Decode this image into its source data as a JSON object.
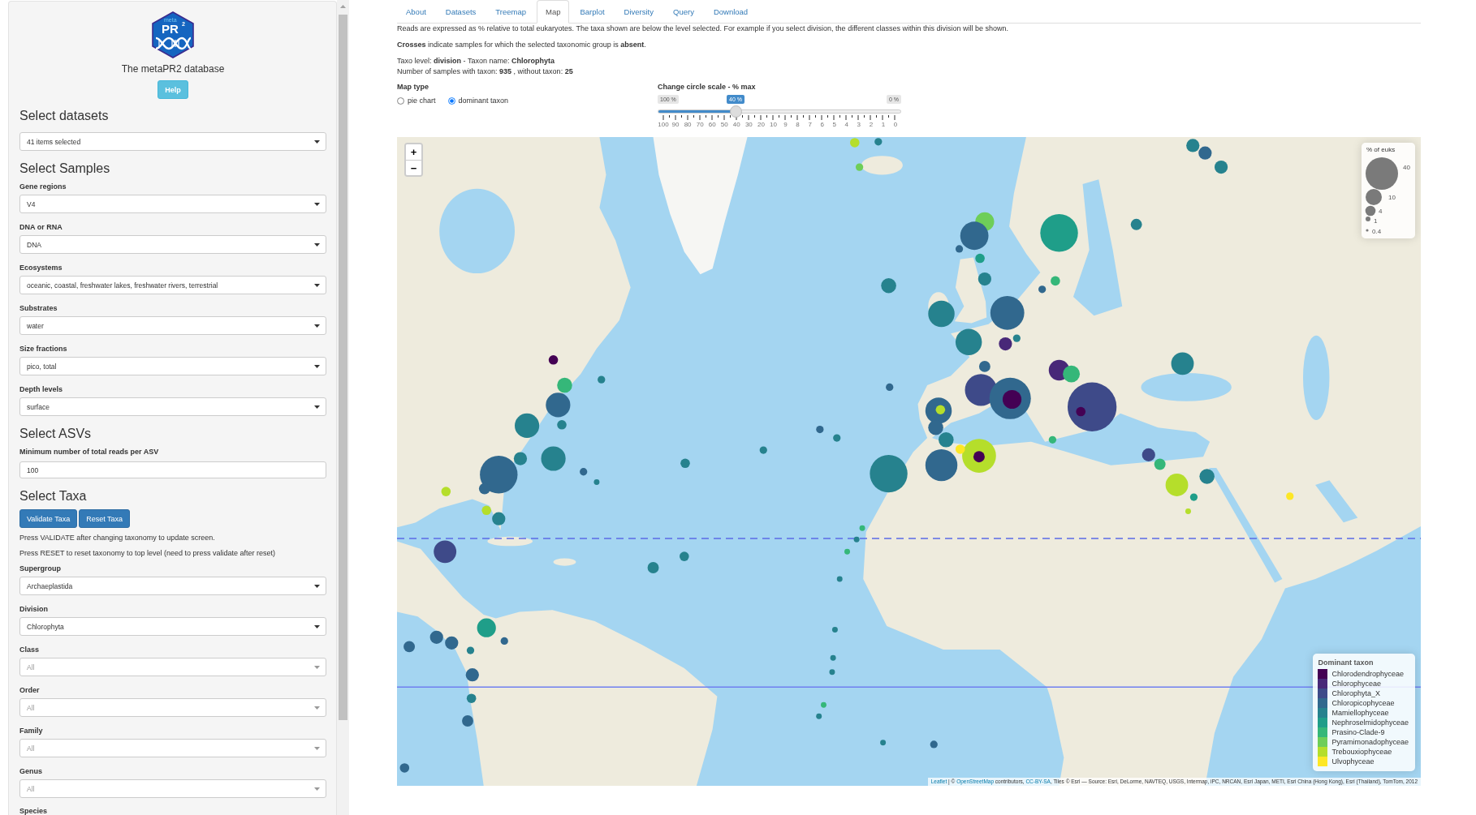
{
  "sidebar": {
    "logo": {
      "small": "meta",
      "main": "PR",
      "sup": "2"
    },
    "title": "The metaPR2 database",
    "help_button": "Help",
    "sections": [
      {
        "heading": "Select datasets",
        "items": [
          {
            "kind": "select",
            "value": "41 items selected"
          }
        ]
      },
      {
        "heading": "Select Samples",
        "items": [
          {
            "kind": "select",
            "label": "Gene regions",
            "value": "V4"
          },
          {
            "kind": "select",
            "label": "DNA or RNA",
            "value": "DNA"
          },
          {
            "kind": "select",
            "label": "Ecosystems",
            "value": "oceanic, coastal, freshwater lakes, freshwater rivers, terrestrial"
          },
          {
            "kind": "select",
            "label": "Substrates",
            "value": "water"
          },
          {
            "kind": "select",
            "label": "Size fractions",
            "value": "pico, total"
          },
          {
            "kind": "select",
            "label": "Depth levels",
            "value": "surface"
          }
        ]
      },
      {
        "heading": "Select ASVs",
        "items": [
          {
            "kind": "input",
            "label": "Minimum number of total reads per ASV",
            "value": "100"
          }
        ]
      },
      {
        "heading": "Select Taxa",
        "items": [
          {
            "kind": "buttons",
            "buttons": [
              "Validate Taxa",
              "Reset Taxa"
            ]
          },
          {
            "kind": "note",
            "text": "Press VALIDATE after changing taxonomy to update screen."
          },
          {
            "kind": "note",
            "text": "Press RESET to reset taxonomy to top level (need to press validate after reset)"
          },
          {
            "kind": "select",
            "label": "Supergroup",
            "value": "Archaeplastida"
          },
          {
            "kind": "select",
            "label": "Division",
            "value": "Chlorophyta"
          },
          {
            "kind": "select",
            "label": "Class",
            "placeholder": "All"
          },
          {
            "kind": "select",
            "label": "Order",
            "placeholder": "All"
          },
          {
            "kind": "select",
            "label": "Family",
            "placeholder": "All"
          },
          {
            "kind": "select",
            "label": "Genus",
            "placeholder": "All"
          },
          {
            "kind": "label",
            "label": "Species"
          }
        ]
      }
    ]
  },
  "tabs": [
    {
      "label": "About",
      "selected": false
    },
    {
      "label": "Datasets",
      "selected": false
    },
    {
      "label": "Treemap",
      "selected": false
    },
    {
      "label": "Map",
      "selected": true
    },
    {
      "label": "Barplot",
      "selected": false
    },
    {
      "label": "Diversity",
      "selected": false
    },
    {
      "label": "Query",
      "selected": false
    },
    {
      "label": "Download",
      "selected": false
    }
  ],
  "info": [
    [
      "Reads are expressed as % relative to total eukaryotes. The taxa shown are below the level selected. For example if you select division, the different classes within this division will be shown."
    ],
    [
      "**Crosses** indicate samples for which the selected taxonomic group is **absent**."
    ],
    [
      "Taxo level: **division** - Taxon name: **Chlorophyta**",
      "Number of samples with taxon: **935** , without taxon: **25**"
    ]
  ],
  "map_type": {
    "label": "Map type",
    "options": [
      {
        "label": "pie chart",
        "selected": false
      },
      {
        "label": "dominant taxon",
        "selected": true
      }
    ]
  },
  "scale_slider": {
    "label": "Change circle scale - % max",
    "min_label": "100 %",
    "max_label": "0 %",
    "value_label": "40 %",
    "level": 0.32,
    "ticks": [
      "100",
      "90",
      "80",
      "70",
      "60",
      "50",
      "40",
      "30",
      "20",
      "10",
      "9",
      "8",
      "7",
      "6",
      "5",
      "4",
      "3",
      "2",
      "1",
      "0"
    ]
  },
  "map": {
    "zoom_controls": [
      "+",
      "−"
    ],
    "size_legend": {
      "title": "% of euks",
      "entries": [
        "40",
        "10",
        "4",
        "1",
        "0.4"
      ]
    },
    "taxon_legend": {
      "title": "Dominant taxon",
      "items": [
        {
          "name": "Chlorodendrophyceae",
          "color": "#440154"
        },
        {
          "name": "Chlorophyceae",
          "color": "#482878"
        },
        {
          "name": "Chlorophyta_X",
          "color": "#3e4a89"
        },
        {
          "name": "Chloropicophyceae",
          "color": "#31688e"
        },
        {
          "name": "Mamiellophyceae",
          "color": "#26828e"
        },
        {
          "name": "Nephroselmidophyceae",
          "color": "#1f9e89"
        },
        {
          "name": "Prasino-Clade-9",
          "color": "#35b779"
        },
        {
          "name": "Pyramimonadophyceae",
          "color": "#6ece58"
        },
        {
          "name": "Trebouxiophyceae",
          "color": "#b5de2b"
        },
        {
          "name": "Ulvophyceae",
          "color": "#fde725"
        }
      ]
    },
    "attribution": [
      {
        "kind": "link",
        "text": "Leaflet"
      },
      {
        "kind": "text",
        "text": " | © "
      },
      {
        "kind": "link",
        "text": "OpenStreetMap"
      },
      {
        "kind": "text",
        "text": " contributors, "
      },
      {
        "kind": "link",
        "text": "CC-BY-SA"
      },
      {
        "kind": "text",
        "text": ", Tiles © Esri — Source: Esri, DeLorme, NAVTEQ, USGS, Intermap, iPC, NRCAN, Esri Japan, METI, Esri China (Hong Kong), Esri (Thailand), TomTom, 2012"
      }
    ],
    "markers": [
      {
        "color": "#b5de2b"
      },
      {
        "color": "#26828e"
      },
      {
        "color": "#6ece58"
      },
      {
        "color": "#26828e"
      },
      {
        "color": "#31688e"
      },
      {
        "color": "#26828e"
      },
      {
        "color": "#6ece58"
      },
      {
        "color": "#31688e"
      },
      {
        "color": "#1f9e89"
      },
      {
        "color": "#1f9e89"
      },
      {
        "color": "#31688e"
      },
      {
        "color": "#26828e"
      },
      {
        "color": "#26828e"
      },
      {
        "color": "#26828e"
      },
      {
        "color": "#26828e"
      },
      {
        "color": "#31688e"
      },
      {
        "color": "#31688e"
      },
      {
        "color": "#35b779"
      },
      {
        "color": "#26828e"
      },
      {
        "color": "#482878"
      },
      {
        "color": "#26828e"
      },
      {
        "color": "#31688e"
      },
      {
        "color": "#26828e"
      },
      {
        "color": "#482878"
      },
      {
        "color": "#35b779"
      },
      {
        "color": "#3e4a89"
      },
      {
        "color": "#440154"
      },
      {
        "color": "#3e4a89"
      },
      {
        "color": "#31688e"
      },
      {
        "color": "#440154"
      },
      {
        "color": "#31688e"
      },
      {
        "color": "#b5de2b"
      },
      {
        "color": "#31688e"
      },
      {
        "color": "#26828e"
      },
      {
        "color": "#31688e"
      },
      {
        "color": "#b5de2b"
      },
      {
        "color": "#440154"
      },
      {
        "color": "#31688e"
      },
      {
        "color": "#26828e"
      },
      {
        "color": "#fde725"
      },
      {
        "color": "#35b779"
      },
      {
        "color": "#3e4a89"
      },
      {
        "color": "#35b779"
      },
      {
        "color": "#26828e"
      },
      {
        "color": "#b5de2b"
      },
      {
        "color": "#1f9e89"
      },
      {
        "color": "#fde725"
      },
      {
        "color": "#440154"
      },
      {
        "color": "#35b779"
      },
      {
        "color": "#31688e"
      },
      {
        "color": "#26828e"
      },
      {
        "color": "#26828e"
      },
      {
        "color": "#26828e"
      },
      {
        "color": "#31688e"
      },
      {
        "color": "#26828e"
      },
      {
        "color": "#26828e"
      },
      {
        "color": "#31688e"
      },
      {
        "color": "#26828e"
      },
      {
        "color": "#b5de2b"
      },
      {
        "color": "#b5de2b"
      },
      {
        "color": "#26828e"
      },
      {
        "color": "#31688e"
      },
      {
        "color": "#3e4a89"
      },
      {
        "color": "#26828e"
      },
      {
        "color": "#26828e"
      },
      {
        "color": "#1f9e89"
      },
      {
        "color": "#31688e"
      },
      {
        "color": "#31688e"
      },
      {
        "color": "#31688e"
      },
      {
        "color": "#26828e"
      },
      {
        "color": "#31688e"
      },
      {
        "color": "#26828e"
      },
      {
        "color": "#31688e"
      },
      {
        "color": "#31688e"
      },
      {
        "color": "#31688e"
      },
      {
        "color": "#26828e"
      },
      {
        "color": "#26828e"
      },
      {
        "color": "#31688e"
      },
      {
        "color": "#26828e"
      },
      {
        "color": "#35b779"
      },
      {
        "color": "#26828e"
      },
      {
        "color": "#35b779"
      },
      {
        "color": "#26828e"
      },
      {
        "color": "#26828e"
      },
      {
        "color": "#35b779"
      },
      {
        "color": "#26828e"
      },
      {
        "color": "#26828e"
      },
      {
        "color": "#26828e"
      },
      {
        "color": "#31688e"
      },
      {
        "color": "#26828e"
      },
      {
        "color": "#b5de2b"
      }
    ]
  }
}
